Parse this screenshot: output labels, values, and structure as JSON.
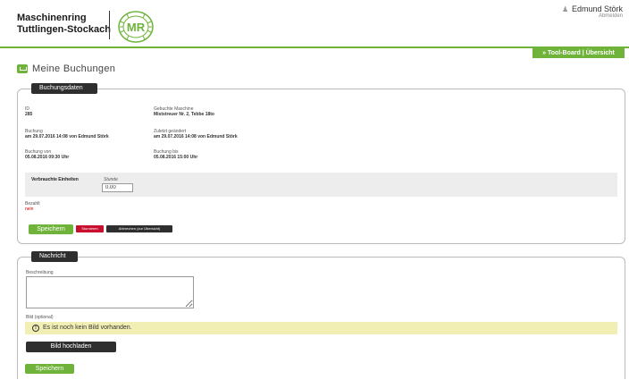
{
  "header": {
    "org_line1": "Maschinenring",
    "org_line2": "Tuttlingen-Stockach",
    "logo_text": "MR",
    "user_icon": "user-icon",
    "user_name": "Edmund Störk",
    "logout": "Abmelden",
    "accent_color": "#6fb33a"
  },
  "toolboard": {
    "label": "» Tool-Board | Übersicht"
  },
  "page": {
    "title": "Meine Buchungen"
  },
  "booking": {
    "legend": "Buchungsdaten",
    "id_label": "ID",
    "id_value": "285",
    "machine_label": "Gebuchte Maschine",
    "machine_value": "Miststreuer Nr. 2, Tebbe 18to",
    "booked_label": "Buchung",
    "booked_value": "am 29.07.2016 14:08 von Edmund Störk",
    "changed_label": "Zuletzt geändert",
    "changed_value": "am 29.07.2016 14:08 von Edmund Störk",
    "from_label": "Buchung von",
    "from_value": "05.08.2016 09:30 Uhr",
    "to_label": "Buchung bis",
    "to_value": "05.08.2016 15:00 Uhr",
    "units_label": "Verbrauchte Einheiten",
    "units_unit": "Stunde",
    "units_value": "0.00",
    "paid_label": "Bezahlt",
    "paid_value": "nein",
    "save_label": "Speichern",
    "cancel_label": "Stornieren",
    "abort_label": "Abbrechen (zur Übersicht)"
  },
  "message": {
    "legend": "Nachricht",
    "desc_label": "Beschreibung",
    "desc_value": "",
    "image_label": "Bild (optional)",
    "info_icon": "info-icon",
    "info_text": "Es ist noch kein Bild vorhanden.",
    "upload_label": "Bild hochladen",
    "save_label": "Speichern"
  }
}
